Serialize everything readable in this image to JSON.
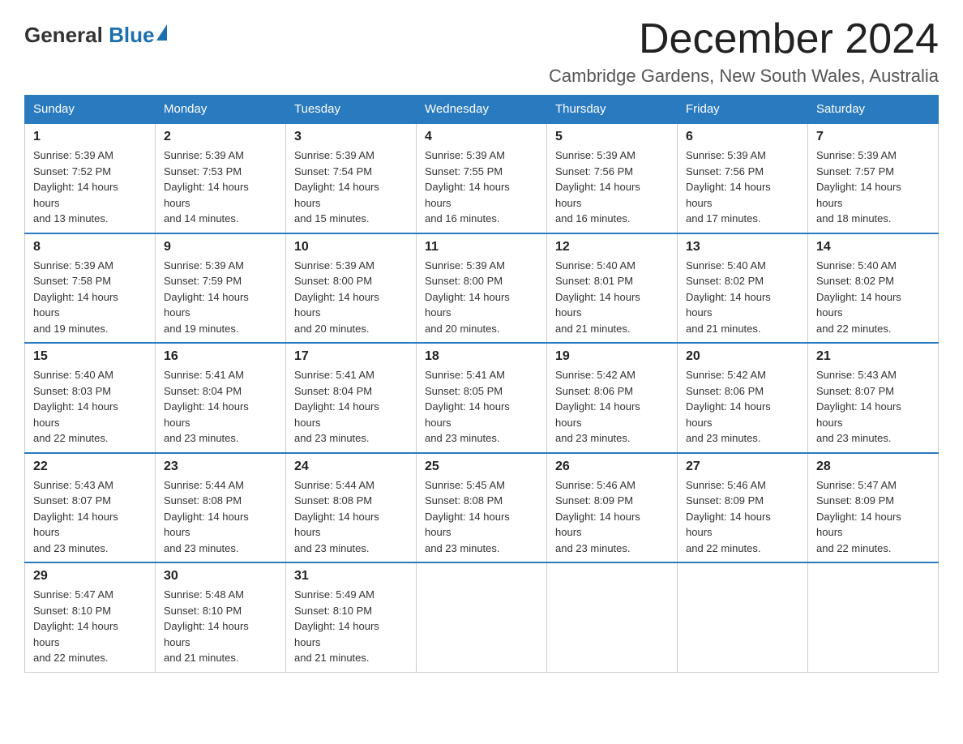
{
  "logo": {
    "text_general": "General",
    "text_blue": "Blue",
    "aria": "GeneralBlue logo"
  },
  "title": "December 2024",
  "subtitle": "Cambridge Gardens, New South Wales, Australia",
  "days_of_week": [
    "Sunday",
    "Monday",
    "Tuesday",
    "Wednesday",
    "Thursday",
    "Friday",
    "Saturday"
  ],
  "weeks": [
    [
      {
        "day": "1",
        "sunrise": "5:39 AM",
        "sunset": "7:52 PM",
        "daylight": "14 hours and 13 minutes."
      },
      {
        "day": "2",
        "sunrise": "5:39 AM",
        "sunset": "7:53 PM",
        "daylight": "14 hours and 14 minutes."
      },
      {
        "day": "3",
        "sunrise": "5:39 AM",
        "sunset": "7:54 PM",
        "daylight": "14 hours and 15 minutes."
      },
      {
        "day": "4",
        "sunrise": "5:39 AM",
        "sunset": "7:55 PM",
        "daylight": "14 hours and 16 minutes."
      },
      {
        "day": "5",
        "sunrise": "5:39 AM",
        "sunset": "7:56 PM",
        "daylight": "14 hours and 16 minutes."
      },
      {
        "day": "6",
        "sunrise": "5:39 AM",
        "sunset": "7:56 PM",
        "daylight": "14 hours and 17 minutes."
      },
      {
        "day": "7",
        "sunrise": "5:39 AM",
        "sunset": "7:57 PM",
        "daylight": "14 hours and 18 minutes."
      }
    ],
    [
      {
        "day": "8",
        "sunrise": "5:39 AM",
        "sunset": "7:58 PM",
        "daylight": "14 hours and 19 minutes."
      },
      {
        "day": "9",
        "sunrise": "5:39 AM",
        "sunset": "7:59 PM",
        "daylight": "14 hours and 19 minutes."
      },
      {
        "day": "10",
        "sunrise": "5:39 AM",
        "sunset": "8:00 PM",
        "daylight": "14 hours and 20 minutes."
      },
      {
        "day": "11",
        "sunrise": "5:39 AM",
        "sunset": "8:00 PM",
        "daylight": "14 hours and 20 minutes."
      },
      {
        "day": "12",
        "sunrise": "5:40 AM",
        "sunset": "8:01 PM",
        "daylight": "14 hours and 21 minutes."
      },
      {
        "day": "13",
        "sunrise": "5:40 AM",
        "sunset": "8:02 PM",
        "daylight": "14 hours and 21 minutes."
      },
      {
        "day": "14",
        "sunrise": "5:40 AM",
        "sunset": "8:02 PM",
        "daylight": "14 hours and 22 minutes."
      }
    ],
    [
      {
        "day": "15",
        "sunrise": "5:40 AM",
        "sunset": "8:03 PM",
        "daylight": "14 hours and 22 minutes."
      },
      {
        "day": "16",
        "sunrise": "5:41 AM",
        "sunset": "8:04 PM",
        "daylight": "14 hours and 23 minutes."
      },
      {
        "day": "17",
        "sunrise": "5:41 AM",
        "sunset": "8:04 PM",
        "daylight": "14 hours and 23 minutes."
      },
      {
        "day": "18",
        "sunrise": "5:41 AM",
        "sunset": "8:05 PM",
        "daylight": "14 hours and 23 minutes."
      },
      {
        "day": "19",
        "sunrise": "5:42 AM",
        "sunset": "8:06 PM",
        "daylight": "14 hours and 23 minutes."
      },
      {
        "day": "20",
        "sunrise": "5:42 AM",
        "sunset": "8:06 PM",
        "daylight": "14 hours and 23 minutes."
      },
      {
        "day": "21",
        "sunrise": "5:43 AM",
        "sunset": "8:07 PM",
        "daylight": "14 hours and 23 minutes."
      }
    ],
    [
      {
        "day": "22",
        "sunrise": "5:43 AM",
        "sunset": "8:07 PM",
        "daylight": "14 hours and 23 minutes."
      },
      {
        "day": "23",
        "sunrise": "5:44 AM",
        "sunset": "8:08 PM",
        "daylight": "14 hours and 23 minutes."
      },
      {
        "day": "24",
        "sunrise": "5:44 AM",
        "sunset": "8:08 PM",
        "daylight": "14 hours and 23 minutes."
      },
      {
        "day": "25",
        "sunrise": "5:45 AM",
        "sunset": "8:08 PM",
        "daylight": "14 hours and 23 minutes."
      },
      {
        "day": "26",
        "sunrise": "5:46 AM",
        "sunset": "8:09 PM",
        "daylight": "14 hours and 23 minutes."
      },
      {
        "day": "27",
        "sunrise": "5:46 AM",
        "sunset": "8:09 PM",
        "daylight": "14 hours and 22 minutes."
      },
      {
        "day": "28",
        "sunrise": "5:47 AM",
        "sunset": "8:09 PM",
        "daylight": "14 hours and 22 minutes."
      }
    ],
    [
      {
        "day": "29",
        "sunrise": "5:47 AM",
        "sunset": "8:10 PM",
        "daylight": "14 hours and 22 minutes."
      },
      {
        "day": "30",
        "sunrise": "5:48 AM",
        "sunset": "8:10 PM",
        "daylight": "14 hours and 21 minutes."
      },
      {
        "day": "31",
        "sunrise": "5:49 AM",
        "sunset": "8:10 PM",
        "daylight": "14 hours and 21 minutes."
      },
      null,
      null,
      null,
      null
    ]
  ],
  "labels": {
    "sunrise": "Sunrise:",
    "sunset": "Sunset:",
    "daylight": "Daylight:"
  }
}
